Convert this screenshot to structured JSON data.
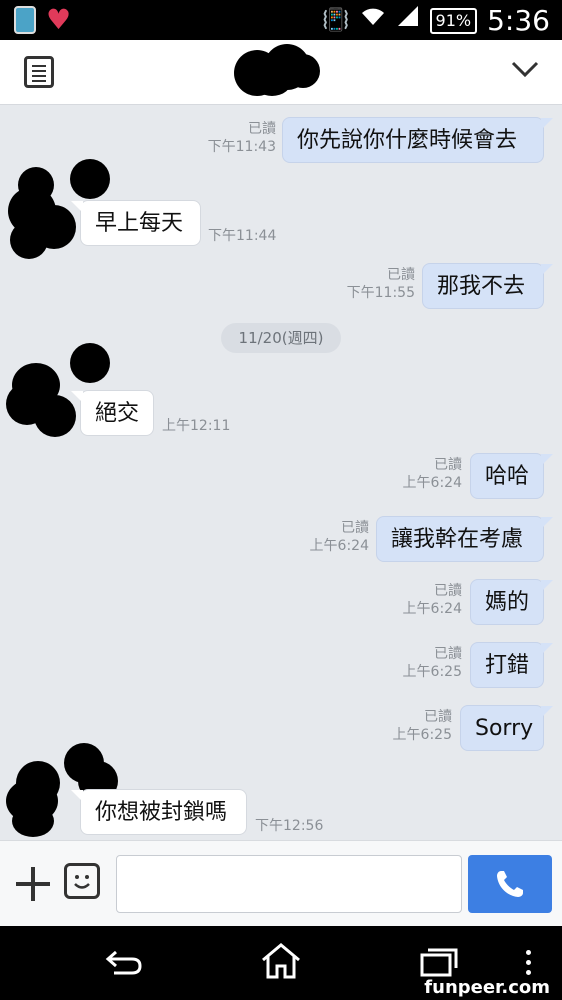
{
  "status_bar": {
    "battery": "91%",
    "time": "5:36"
  },
  "header": {
    "contact_name_redacted": true
  },
  "messages": [
    {
      "side": "mine",
      "text": "你先說你什麼時候會去",
      "read": "已讀",
      "time": "下午11:43"
    },
    {
      "side": "theirs",
      "text": "早上每天",
      "time": "下午11:44"
    },
    {
      "side": "mine",
      "text": "那我不去",
      "read": "已讀",
      "time": "下午11:55"
    },
    {
      "side": "theirs",
      "text": "絕交",
      "time": "上午12:11"
    },
    {
      "side": "mine",
      "text": "哈哈",
      "read": "已讀",
      "time": "上午6:24"
    },
    {
      "side": "mine",
      "text": "讓我幹在考慮",
      "read": "已讀",
      "time": "上午6:24"
    },
    {
      "side": "mine",
      "text": "媽的",
      "read": "已讀",
      "time": "上午6:24"
    },
    {
      "side": "mine",
      "text": "打錯",
      "read": "已讀",
      "time": "上午6:25"
    },
    {
      "side": "mine",
      "text": "Sorry",
      "read": "已讀",
      "time": "上午6:25"
    },
    {
      "side": "theirs",
      "text": "你想被封鎖嗎",
      "time": "下午12:56"
    }
  ],
  "date_divider": "11/20(週四)",
  "input_bar": {
    "placeholder": ""
  },
  "watermark": "funpeer.com",
  "colors": {
    "accent": "#3d7fe3",
    "my_bubble": "#d5e2f7",
    "chat_bg": "#e6e9ed"
  }
}
